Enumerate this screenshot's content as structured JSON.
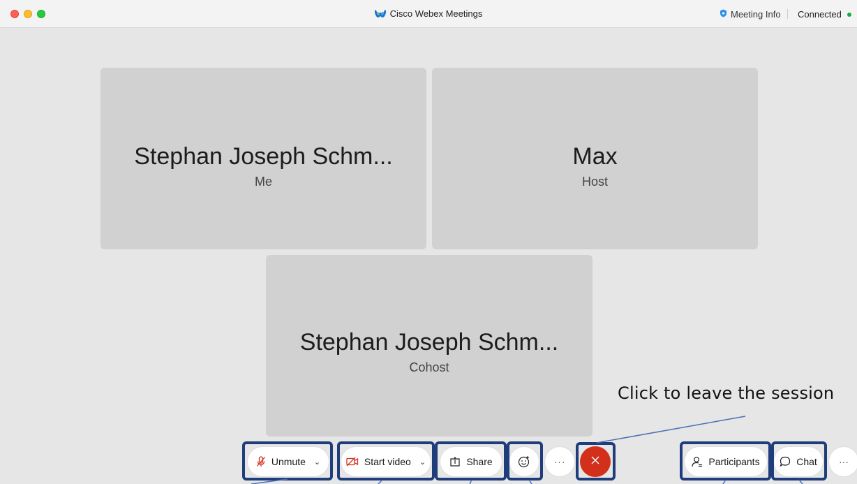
{
  "window": {
    "title": "Cisco Webex Meetings",
    "meeting_info_label": "Meeting Info",
    "connection_status": "Connected",
    "status_color": "#1fa83b"
  },
  "tiles": [
    {
      "name": "Stephan Joseph Schm...",
      "role": "Me"
    },
    {
      "name": "Max",
      "role": "Host"
    },
    {
      "name": "Stephan Joseph Schm...",
      "role": "Cohost"
    }
  ],
  "controls": {
    "unmute_label": "Unmute",
    "start_video_label": "Start video",
    "share_label": "Share",
    "more_label": "···",
    "participants_label": "Participants",
    "chat_label": "Chat"
  },
  "annotation": {
    "leave_callout": "Click to leave the session"
  },
  "colors": {
    "leave_button": "#d3301c",
    "highlight_border": "#1e3d7a"
  }
}
